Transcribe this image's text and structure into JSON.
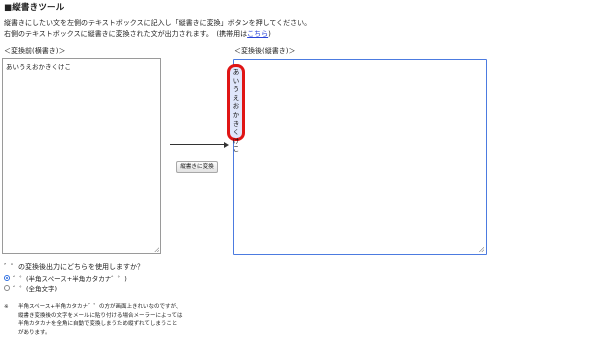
{
  "header": {
    "title": "■縦書きツール"
  },
  "instructions": {
    "line1": "縦書きにしたい文を左側のテキストボックスに記入し「縦書きに変換」ボタンを押してください。",
    "line2_prefix": "右側のテキストボックスに縦書きに変換された文が出力されます。　(携帯用は",
    "line2_link": "こちら",
    "line2_suffix": ")"
  },
  "input_panel": {
    "label": "＜変換前(横書き)＞",
    "value": "あいうえおかきくけこ"
  },
  "convert_button": {
    "label": "縦書きに変換"
  },
  "output_panel": {
    "label": "＜変換後(縦書き)＞",
    "chars": [
      "あ",
      "い",
      "う",
      "え",
      "お",
      "か",
      "き",
      "く",
      "け",
      "こ"
    ]
  },
  "options": {
    "question": "゛゜の変換後出力にどちらを使用しますか？",
    "choice1": "゛゜(半角スペース+半角カタカナ゛゜)",
    "choice2": "゛゜(全角文字)",
    "selected": 1
  },
  "note": {
    "mark": "※",
    "lines": [
      "半角スペース+半角カタカナ゛゜の方が画面上きれいなのですが、",
      "縦書き変換後の文字をメールに貼り付ける場合メーラーによっては",
      "半角カタカナを全角に自動で変換しまうため縦ずれてしまうこと",
      "があります。"
    ]
  },
  "colors": {
    "highlight_border": "#e01515",
    "output_border": "#4c7be0",
    "link": "#2a45d8"
  }
}
